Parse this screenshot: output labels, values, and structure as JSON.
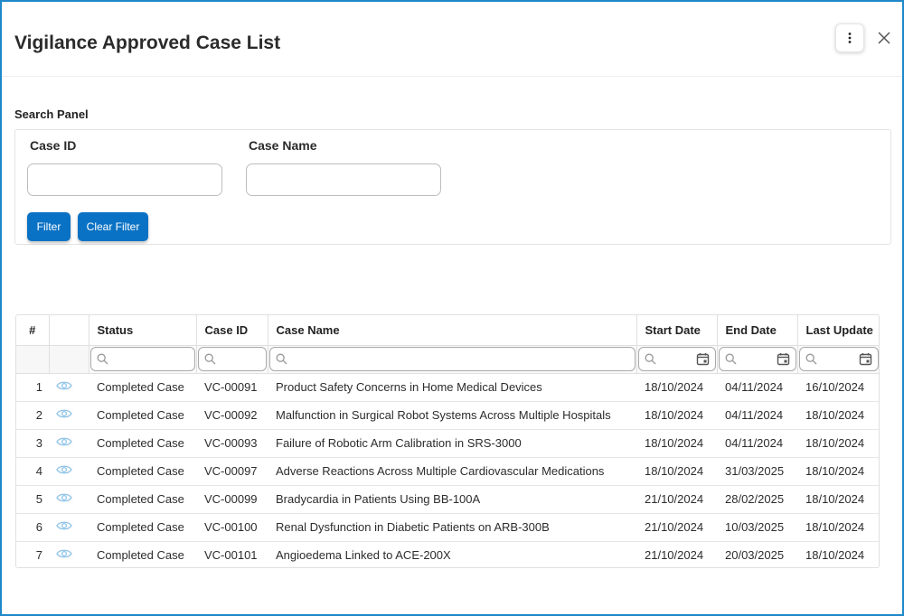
{
  "dialog": {
    "title": "Vigilance Approved Case List",
    "menu_icon": "kebab-vertical-icon",
    "close_icon": "close-icon"
  },
  "search_panel": {
    "title": "Search Panel",
    "case_id_label": "Case ID",
    "case_id_value": "",
    "case_name_label": "Case Name",
    "case_name_value": "",
    "filter_label": "Filter",
    "clear_filter_label": "Clear Filter"
  },
  "table": {
    "columns": [
      "#",
      "",
      "Status",
      "Case ID",
      "Case Name",
      "Start Date",
      "End Date",
      "Last Update"
    ],
    "rows": [
      {
        "num": "1",
        "status": "Completed Case",
        "case_id": "VC-00091",
        "case_name": "Product Safety Concerns in Home Medical Devices",
        "start": "18/10/2024",
        "end": "04/11/2024",
        "update": "16/10/2024"
      },
      {
        "num": "2",
        "status": "Completed Case",
        "case_id": "VC-00092",
        "case_name": "Malfunction in Surgical Robot Systems Across Multiple Hospitals",
        "start": "18/10/2024",
        "end": "04/11/2024",
        "update": "18/10/2024"
      },
      {
        "num": "3",
        "status": "Completed Case",
        "case_id": "VC-00093",
        "case_name": "Failure of Robotic Arm Calibration in SRS-3000",
        "start": "18/10/2024",
        "end": "04/11/2024",
        "update": "18/10/2024"
      },
      {
        "num": "4",
        "status": "Completed Case",
        "case_id": "VC-00097",
        "case_name": "Adverse Reactions Across Multiple Cardiovascular Medications",
        "start": "18/10/2024",
        "end": "31/03/2025",
        "update": "18/10/2024"
      },
      {
        "num": "5",
        "status": "Completed Case",
        "case_id": "VC-00099",
        "case_name": "Bradycardia in Patients Using BB-100A",
        "start": "21/10/2024",
        "end": "28/02/2025",
        "update": "18/10/2024"
      },
      {
        "num": "6",
        "status": "Completed Case",
        "case_id": "VC-00100",
        "case_name": "Renal Dysfunction in Diabetic Patients on ARB-300B",
        "start": "21/10/2024",
        "end": "10/03/2025",
        "update": "18/10/2024"
      },
      {
        "num": "7",
        "status": "Completed Case",
        "case_id": "VC-00101",
        "case_name": "Angioedema Linked to ACE-200X",
        "start": "21/10/2024",
        "end": "20/03/2025",
        "update": "18/10/2024"
      }
    ]
  },
  "colors": {
    "accent": "#0a72c4",
    "border": "#1e88c9",
    "eye_icon": "#8fc3e8"
  }
}
